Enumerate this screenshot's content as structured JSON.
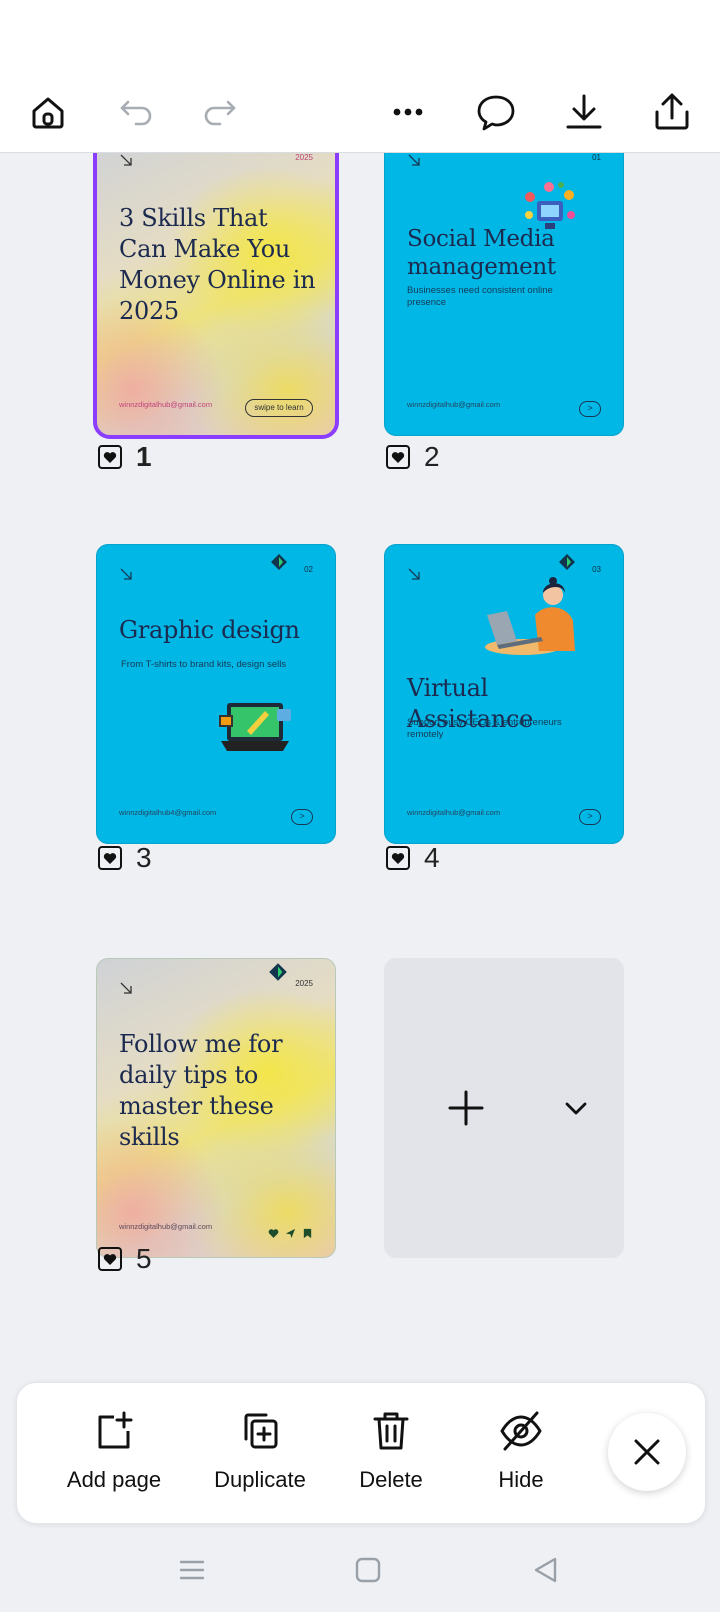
{
  "toolbar": {
    "icons": [
      "home-icon",
      "undo-icon",
      "redo-icon",
      "more-icon",
      "comment-icon",
      "download-icon",
      "share-icon"
    ]
  },
  "pages": [
    {
      "number": "1",
      "page_tag": "2025",
      "title": "3 Skills That Can Make You Money Online in 2025",
      "subtitle": "",
      "email": "winnzdigitalhub@gmail.com",
      "cta": "swipe to learn",
      "selected": true
    },
    {
      "number": "2",
      "page_tag": "01",
      "title": "Social Media management",
      "subtitle": "Businesses need consistent online presence",
      "email": "winnzdigitalhub@gmail.com",
      "cta": ">"
    },
    {
      "number": "3",
      "page_tag": "02",
      "title": "Graphic design",
      "subtitle": "From T-shirts to brand kits, design sells",
      "email": "winnzdigitalhub4@gmail.com",
      "cta": ">"
    },
    {
      "number": "4",
      "page_tag": "03",
      "title": "Virtual Assistance",
      "subtitle": "Support busy CEOs & entrepreneurs remotely",
      "email": "winnzdigitalhub@gmail.com",
      "cta": ">"
    },
    {
      "number": "5",
      "page_tag": "2025",
      "title": "Follow me for daily tips to master these skills",
      "subtitle": "",
      "email": "winnzdigitalhub@gmail.com",
      "cta": ""
    }
  ],
  "actions": {
    "add_page": "Add page",
    "duplicate": "Duplicate",
    "delete": "Delete",
    "hide": "Hide"
  },
  "colors": {
    "accent_selected": "#8b3dff",
    "card_blue": "#00b7e6",
    "background": "#eef0f4"
  }
}
